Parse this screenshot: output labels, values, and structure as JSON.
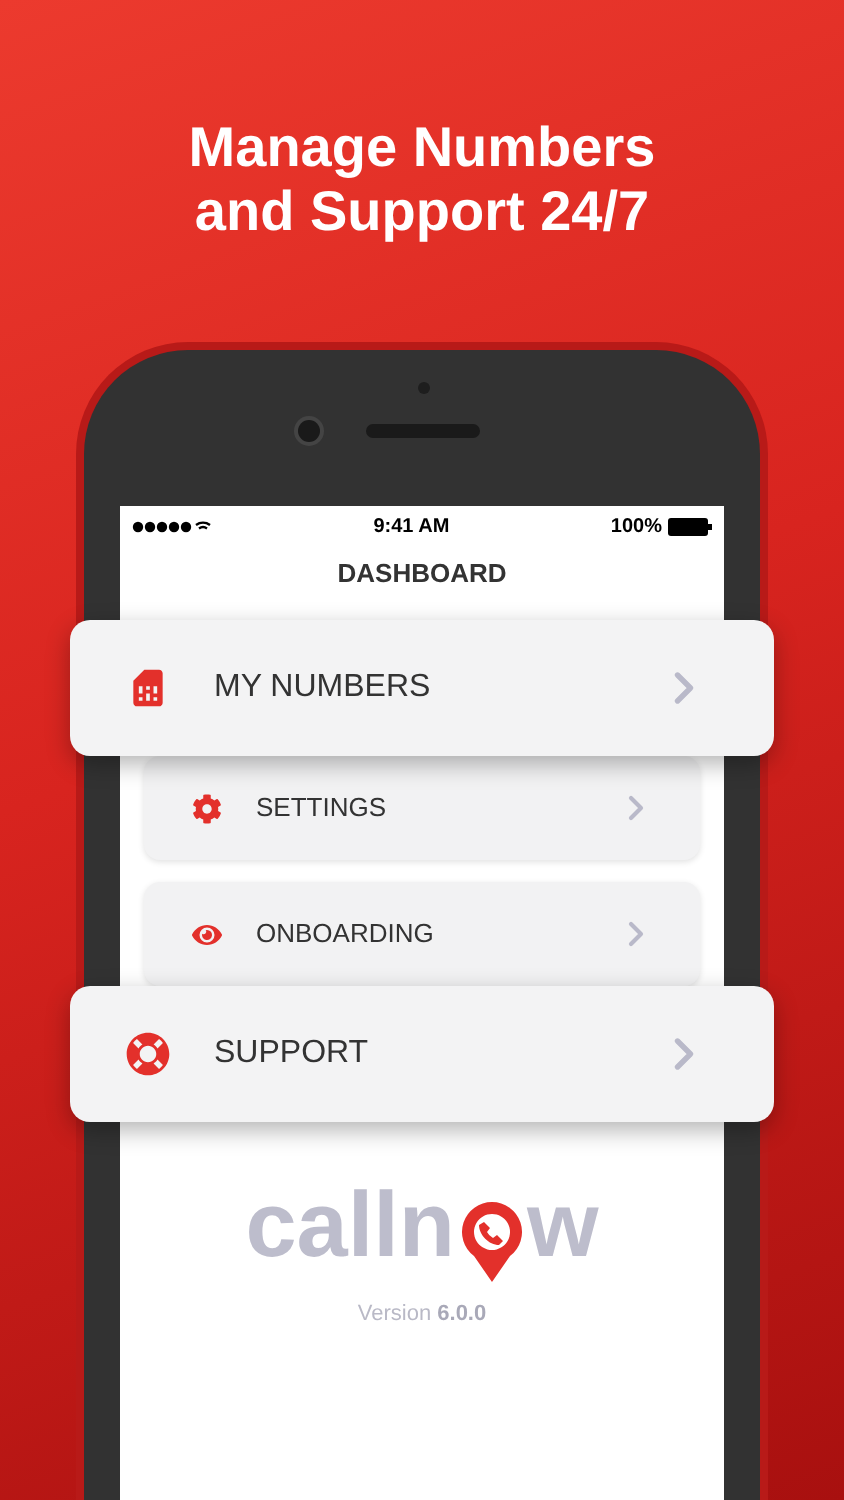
{
  "headline": [
    "Manage Numbers",
    "and Support 24/7"
  ],
  "status_bar": {
    "time": "9:41 AM",
    "battery": "100%"
  },
  "title": "DASHBOARD",
  "menu": [
    {
      "label": "MY NUMBERS",
      "raised": true
    },
    {
      "label": "SETTINGS",
      "raised": false
    },
    {
      "label": "ONBOARDING",
      "raised": false
    },
    {
      "label": "SUPPORT",
      "raised": true
    }
  ],
  "logo": {
    "before": "calln",
    "after": "w"
  },
  "version": {
    "label": "Version",
    "number": "6.0.0"
  }
}
